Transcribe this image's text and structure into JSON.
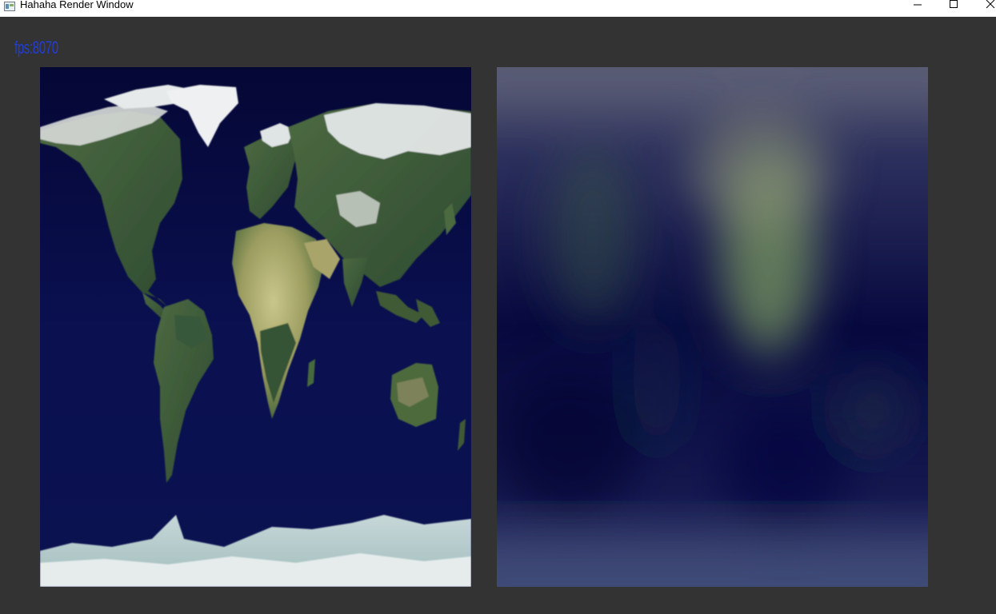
{
  "window": {
    "title": "Hahaha Render Window"
  },
  "overlay": {
    "fps_text": "fps:8070"
  },
  "viewports": {
    "left": {
      "content": "world-map-texture"
    },
    "right": {
      "content": "blurred-world-map-texture"
    }
  },
  "colors": {
    "client_background": "#333333",
    "fps_text": "#1f3fd8",
    "ocean": "#06083f",
    "land": "#3f5a36",
    "desert": "#b7b67a",
    "ice": "#dfe6e8"
  }
}
